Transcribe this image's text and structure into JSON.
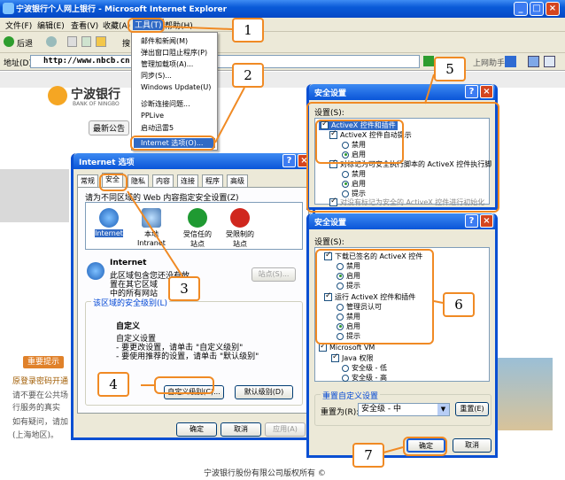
{
  "window": {
    "title": "宁波银行个人网上银行 - Microsoft Internet Explorer",
    "min": "_",
    "max": "□",
    "close": "×"
  },
  "menu": [
    "文件(F)",
    "编辑(E)",
    "查看(V)",
    "收藏(A)",
    "工具(T)",
    "帮助(H)"
  ],
  "toolbar": {
    "back": "后退",
    "search": "搜"
  },
  "address": {
    "label": "地址(D)",
    "url": "http://www.nbcb.cn",
    "go": "转",
    "assist": "上网助手"
  },
  "tools_menu": [
    "邮件和新闻(M)",
    "弹出窗口阻止程序(P)",
    "管理加载项(A)...",
    "同步(S)...",
    "Windows Update(U)",
    "诊断连接问题...",
    "PPLive",
    "启动迅雷5",
    "Internet 选项(O)..."
  ],
  "bank": {
    "name": "宁波银行",
    "sub": "BANK OF NINGBO",
    "notice": "最新公告",
    "tips_title": "重要提示",
    "tips": [
      "原登录密码开通",
      "请不要在公共场",
      "行服务的真实",
      "如有疑问，请加",
      "(上海地区)。"
    ],
    "footer": "宁波银行股份有限公司版权所有 ©"
  },
  "internet_options": {
    "title": "Internet 选项",
    "tabs": [
      "常规",
      "安全",
      "隐私",
      "内容",
      "连接",
      "程序",
      "高级"
    ],
    "zones_prompt": "请为不同区域的 Web 内容指定安全设置(Z)",
    "zones": [
      "Internet",
      "本地 Intranet",
      "受信任的站点",
      "受限制的站点"
    ],
    "zone_heading": "Internet",
    "zone_desc": [
      "此区域包含您还没有放",
      "置在其它区域",
      "中的所有网站"
    ],
    "sites_btn": "站点(S)...",
    "level_label": "该区域的安全级别(L)",
    "custom_title": "自定义",
    "custom_desc": [
      "自定义设置",
      "- 要更改设置，请单击 \"自定义级别\"",
      "- 要使用推荐的设置，请单击 \"默认级别\""
    ],
    "custom_btn": "自定义级别(C)...",
    "default_btn": "默认级别(D)",
    "ok": "确定",
    "cancel": "取消",
    "apply": "应用(A)"
  },
  "security1": {
    "title": "安全设置",
    "settings_label": "设置(S):",
    "items": [
      {
        "kind": "group",
        "text": "ActiveX 控件和插件"
      },
      {
        "kind": "group",
        "text": "ActiveX 控件自动提示"
      },
      {
        "kind": "radio",
        "text": "禁用",
        "on": false
      },
      {
        "kind": "radio",
        "text": "启用",
        "on": true
      },
      {
        "kind": "group",
        "text": "对标记为可安全执行脚本的 ActiveX 控件执行脚"
      },
      {
        "kind": "radio",
        "text": "禁用",
        "on": false
      },
      {
        "kind": "radio",
        "text": "启用",
        "on": true
      },
      {
        "kind": "radio",
        "text": "提示",
        "on": false
      },
      {
        "kind": "group",
        "text": "对没有标记为安全的 ActiveX 控件进行初始化"
      }
    ]
  },
  "security2": {
    "title": "安全设置",
    "settings_label": "设置(S):",
    "items": [
      {
        "kind": "group",
        "text": "下载已签名的 ActiveX 控件"
      },
      {
        "kind": "radio",
        "text": "禁用",
        "on": false
      },
      {
        "kind": "radio",
        "text": "启用",
        "on": true
      },
      {
        "kind": "radio",
        "text": "提示",
        "on": false
      },
      {
        "kind": "group",
        "text": "运行 ActiveX 控件和插件"
      },
      {
        "kind": "radio",
        "text": "管理员认可",
        "on": false
      },
      {
        "kind": "radio",
        "text": "禁用",
        "on": false
      },
      {
        "kind": "radio",
        "text": "启用",
        "on": true
      },
      {
        "kind": "radio",
        "text": "提示",
        "on": false
      },
      {
        "kind": "group",
        "text": "Microsoft VM"
      },
      {
        "kind": "sub",
        "text": "Java 权限"
      },
      {
        "kind": "radio",
        "text": "安全级 - 低",
        "on": false
      },
      {
        "kind": "radio",
        "text": "安全级 - 高",
        "on": false
      }
    ],
    "reset_group": "重置自定义设置",
    "reset_label": "重置为(R):",
    "reset_value": "安全级 - 中",
    "reset_btn": "重置(E)",
    "ok": "确定",
    "cancel": "取消"
  },
  "callouts": [
    "1",
    "2",
    "3",
    "4",
    "5",
    "6",
    "7"
  ],
  "colors": {
    "xp_blue": "#0a55d8",
    "callout_orange": "#f08a24",
    "close_red": "#d4451f"
  }
}
